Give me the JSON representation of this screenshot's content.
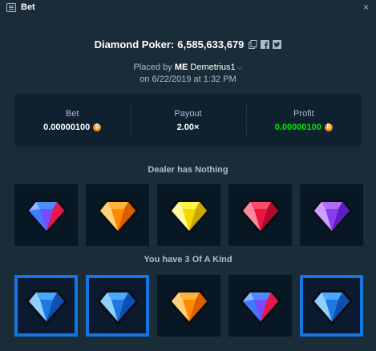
{
  "window": {
    "title": "Bet",
    "close_label": "×"
  },
  "game": {
    "name": "Diamond Poker:",
    "bet_id": "6,585,633,679",
    "placed_by_prefix": "Placed by",
    "placed_by_badge": "ME",
    "username": "Demetrius1",
    "date": "on 6/22/2019 at 1:32 PM"
  },
  "stats": {
    "bet_label": "Bet",
    "bet_value": "0.00000100",
    "payout_label": "Payout",
    "payout_value": "2.00×",
    "profit_label": "Profit",
    "profit_value": "0.00000100",
    "currency_glyph": "₿"
  },
  "dealer": {
    "label": "Dealer has Nothing",
    "gems": [
      "blue-red",
      "orange",
      "yellow",
      "red",
      "purple"
    ]
  },
  "player": {
    "label": "You have 3 Of A Kind",
    "gems": [
      "blue",
      "blue",
      "orange",
      "blue-red",
      "blue"
    ],
    "highlighted": [
      true,
      true,
      false,
      false,
      true
    ]
  },
  "colors": {
    "background": "#1a2c38",
    "panel": "#0f212e",
    "card": "#071824",
    "highlight": "#1475e1",
    "profit": "#00e701",
    "coin": "#f7931a"
  }
}
